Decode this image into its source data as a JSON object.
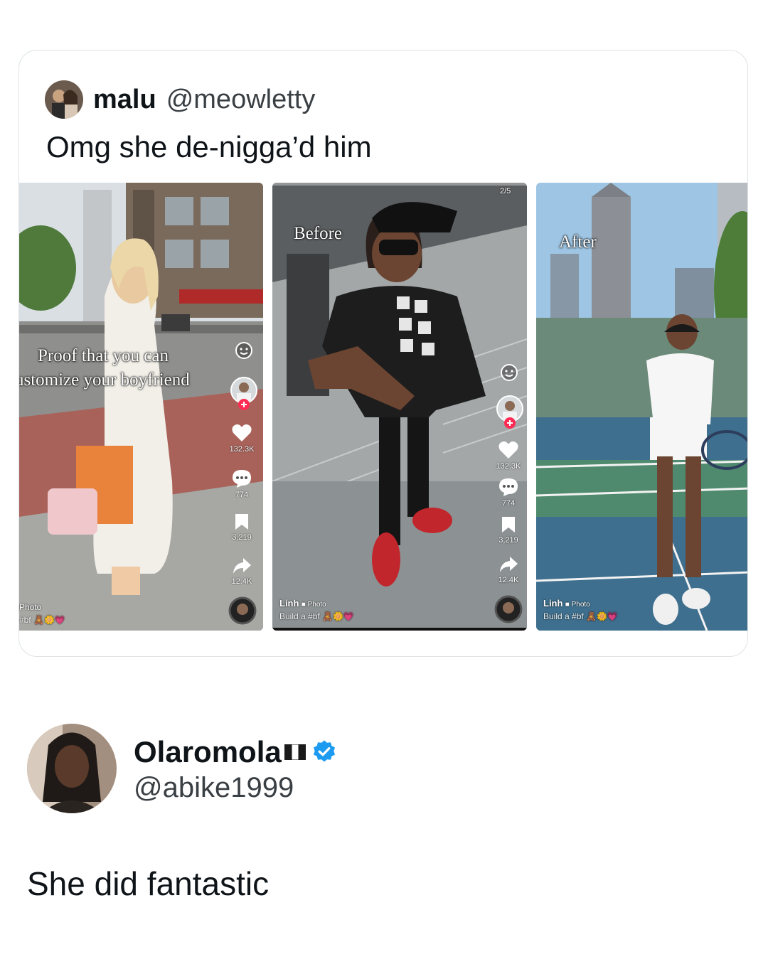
{
  "quoted_tweet": {
    "name": "malu",
    "handle": "@meowletty",
    "text": "Omg she de-nigga’d him",
    "panels": [
      {
        "caption_line1": "Proof that you can",
        "caption_line2": "ustomize your boyfriend",
        "likes": "132.3K",
        "comments": "774",
        "saves": "3,219",
        "shares": "12.4K",
        "meta_type": "Photo",
        "meta_tag": "#bf"
      },
      {
        "caption": "Before",
        "page_indicator": "2/5",
        "likes": "132.3K",
        "comments": "774",
        "saves": "3,219",
        "shares": "12.4K",
        "author": "Linh",
        "meta_type": "Photo",
        "meta_desc": "Build a #bf"
      },
      {
        "caption": "After",
        "author": "Linh",
        "meta_type": "Photo",
        "meta_desc": "Build a #bf"
      }
    ]
  },
  "reply": {
    "name": "Olaromola",
    "flag_icon": "nigeria-flag-icon",
    "verified_icon": "verified-badge-icon",
    "handle": "@abike1999",
    "text": "She did fantastic"
  },
  "colors": {
    "verified_blue": "#1d9bf0",
    "card_border": "#dfe3e6",
    "text_primary": "#0f1419",
    "text_secondary": "#3a3f44"
  }
}
